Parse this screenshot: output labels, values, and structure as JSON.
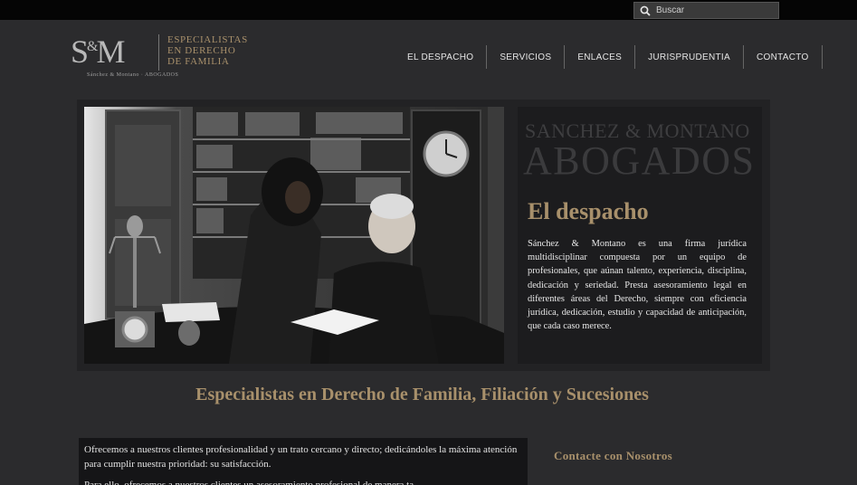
{
  "search": {
    "placeholder": "Buscar"
  },
  "logo": {
    "monogram_left": "S",
    "monogram_amp": "&",
    "monogram_right": "M",
    "subtitle": "Sánchez & Montano",
    "subtitle2": "ABOGADOS"
  },
  "tagline": {
    "line1": "ESPECIALISTAS",
    "line2": "EN DERECHO",
    "line3": "DE FAMILIA"
  },
  "nav": {
    "items": [
      "EL DESPACHO",
      "SERVICIOS",
      "ENLACES",
      "JURISPRUDENTIA",
      "CONTACTO"
    ]
  },
  "hero": {
    "firm_line1": "SANCHEZ & MONTANO",
    "firm_line2": "ABOGADOS",
    "heading": "El despacho",
    "description": "Sánchez & Montano es una firma jurídica multidisciplinar compuesta por un equipo de profesionales, que aúnan talento, experiencia, disciplina, dedicación y seriedad. Presta asesoramiento legal en diferentes áreas del Derecho, siempre con eficiencia jurídica, dedicación, estudio y capacidad de anticipación, que cada caso merece."
  },
  "section": {
    "title": "Especialistas en Derecho de Familia, Filiación y Sucesiones"
  },
  "intro": {
    "p1": "Ofrecemos a nuestros clientes profesionalidad y un trato cercano y directo; dedicándoles la máxima atención para cumplir nuestra prioridad: su satisfacción.",
    "p2": "Para ello, ofrecemos a nuestros clientes un asesoramiento profesional de manera ta…"
  },
  "contact": {
    "heading": "Contacte con Nosotros"
  },
  "colors": {
    "accent": "#a8906b",
    "background": "#2b2b2d",
    "topbar": "#050505"
  }
}
